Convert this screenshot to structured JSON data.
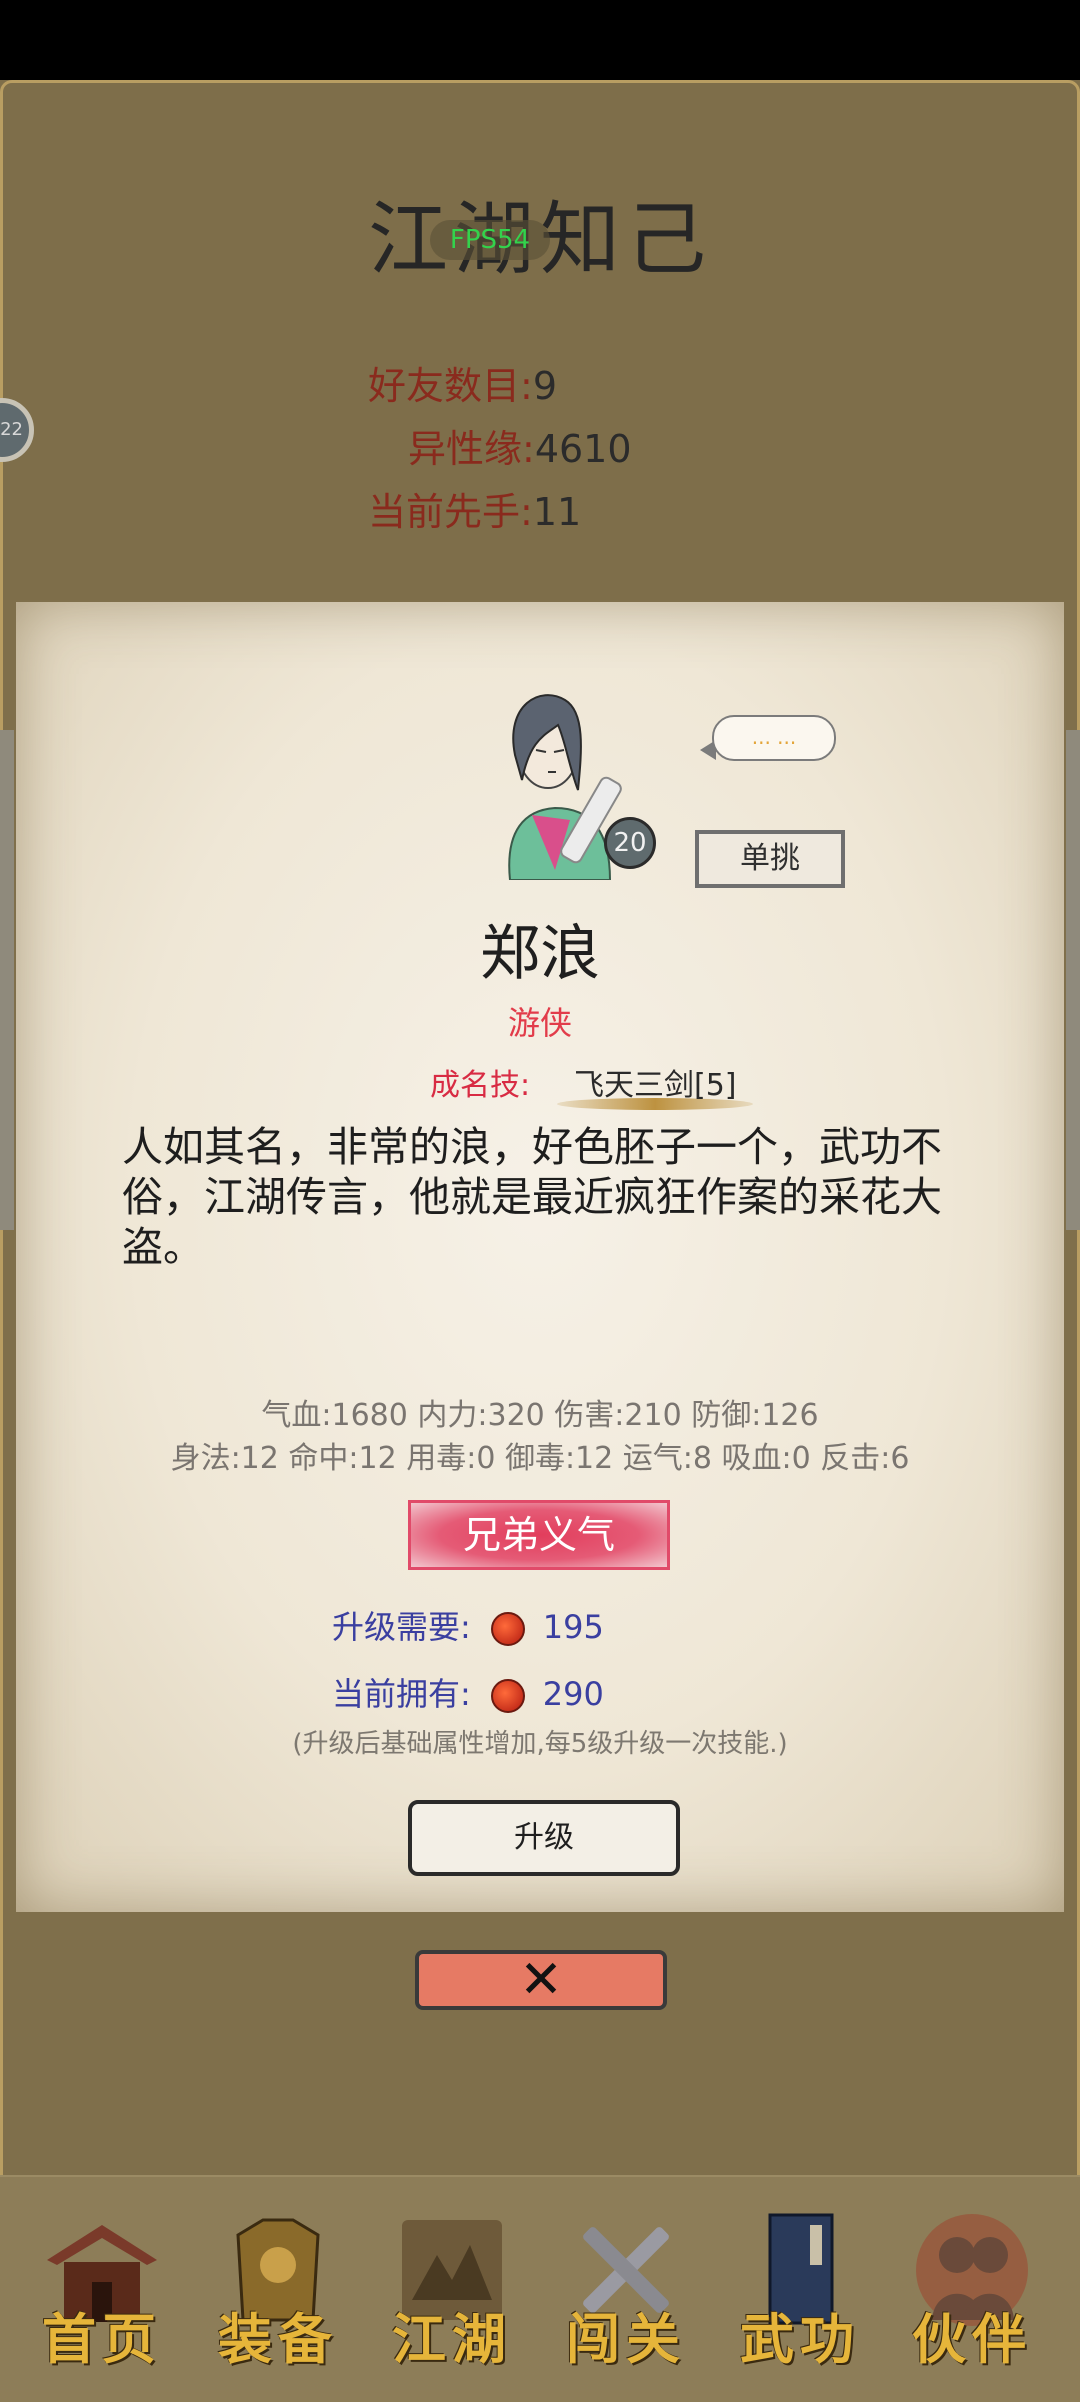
{
  "page": {
    "title": "江湖知己",
    "fps": "FPS54",
    "side_avatar_text": "22"
  },
  "stats": {
    "friends_label": "好友数目:",
    "friends_value": "9",
    "charm_label": "异性缘:",
    "charm_value": "4610",
    "initiative_label": "当前先手:",
    "initiative_value": "11"
  },
  "card": {
    "level": "20",
    "bubble": "... ...",
    "duel_button": "单挑",
    "name": "郑浪",
    "role": "游侠",
    "famous_label": "成名技:",
    "famous_skill": "飞天三剑[5]",
    "description": "人如其名，非常的浪，好色胚子一个，武功不俗，江湖传言，他就是最近疯狂作案的采花大盗。",
    "attrs_line1": "气血:1680  内力:320  伤害:210  防御:126",
    "attrs_line2": "身法:12  命中:12  用毒:0  御毒:12  运气:8  吸血:0  反击:6",
    "brotherhood": "兄弟义气",
    "need_label": "升级需要:",
    "need_value": "195",
    "own_label": "当前拥有:",
    "own_value": "290",
    "note": "(升级后基础属性增加,每5级升级一次技能.)",
    "upgrade_button": "升级",
    "close_symbol": "✕"
  },
  "nav": {
    "items": [
      {
        "label": "首页",
        "icon": "house-icon",
        "color": "#7a3a2a"
      },
      {
        "label": "装备",
        "icon": "armor-icon",
        "color": "#8a6a2a"
      },
      {
        "label": "江湖",
        "icon": "scroll-map-icon",
        "color": "#6e5a3a"
      },
      {
        "label": "闯关",
        "icon": "crossed-swords-icon",
        "color": "#8a8a90"
      },
      {
        "label": "武功",
        "icon": "book-icon",
        "color": "#2a3a5a"
      },
      {
        "label": "伙伴",
        "icon": "partners-icon",
        "color": "#8a3a2a"
      }
    ]
  }
}
